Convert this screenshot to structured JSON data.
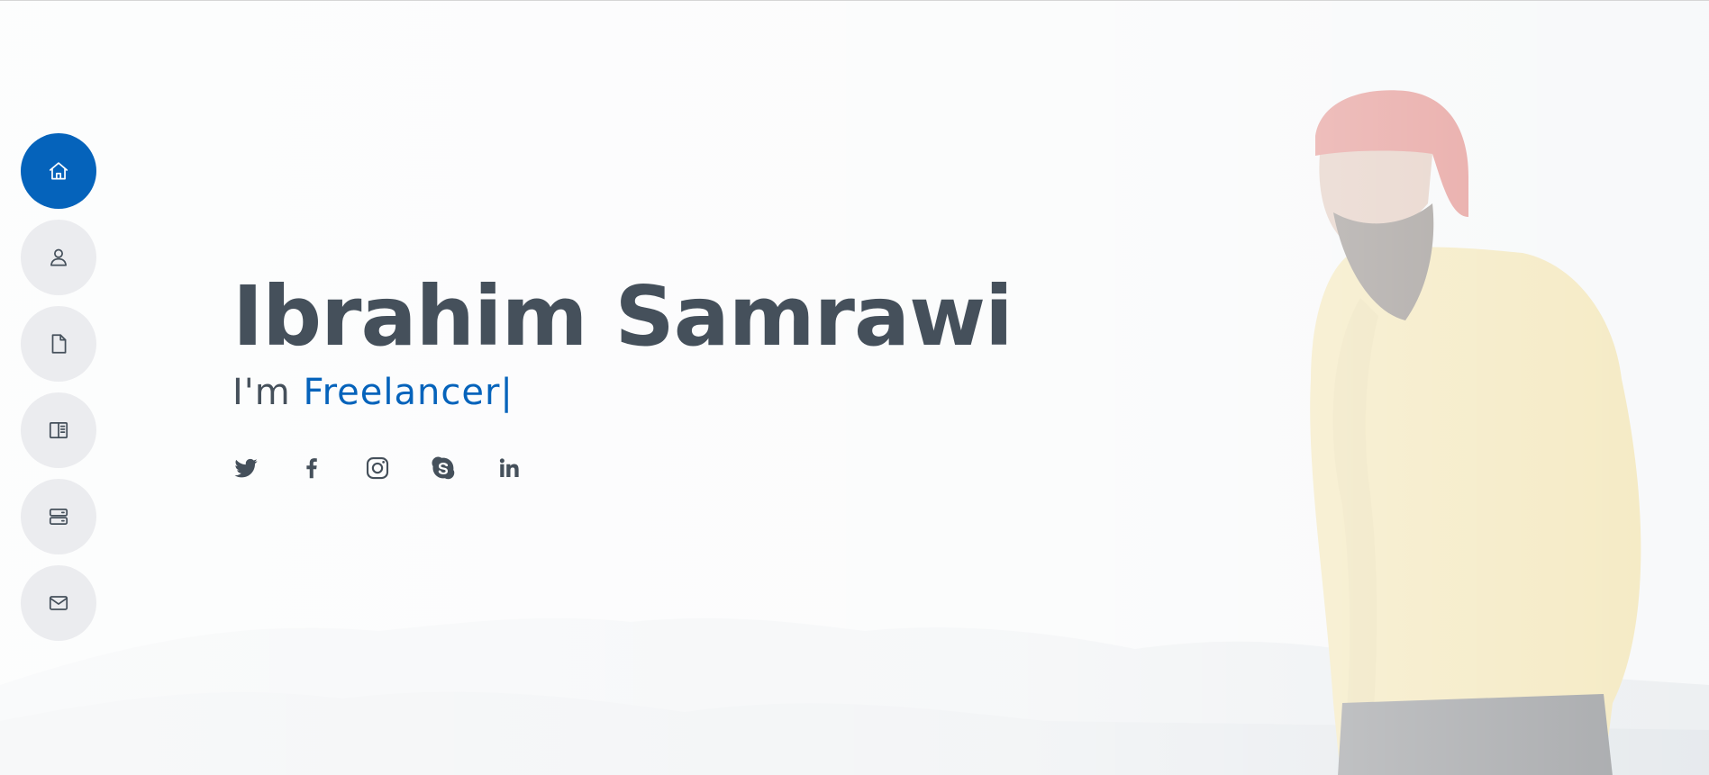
{
  "hero": {
    "name": "Ibrahim Samrawi",
    "tagline_prefix": "I'm",
    "tagline_role": "Freelancer",
    "cursor": "|"
  },
  "colors": {
    "accent": "#0563bb",
    "text": "#45505b",
    "nav_bg": "#ebecef",
    "hat": "#c9322b",
    "sweater": "#e8d07a"
  },
  "nav": {
    "items": [
      {
        "icon": "house-icon",
        "active": true
      },
      {
        "icon": "person-icon",
        "active": false
      },
      {
        "icon": "file-icon",
        "active": false
      },
      {
        "icon": "book-half-icon",
        "active": false
      },
      {
        "icon": "server-icon",
        "active": false
      },
      {
        "icon": "envelope-icon",
        "active": false
      }
    ]
  },
  "social": [
    "twitter-icon",
    "facebook-icon",
    "instagram-icon",
    "skype-icon",
    "linkedin-icon"
  ]
}
